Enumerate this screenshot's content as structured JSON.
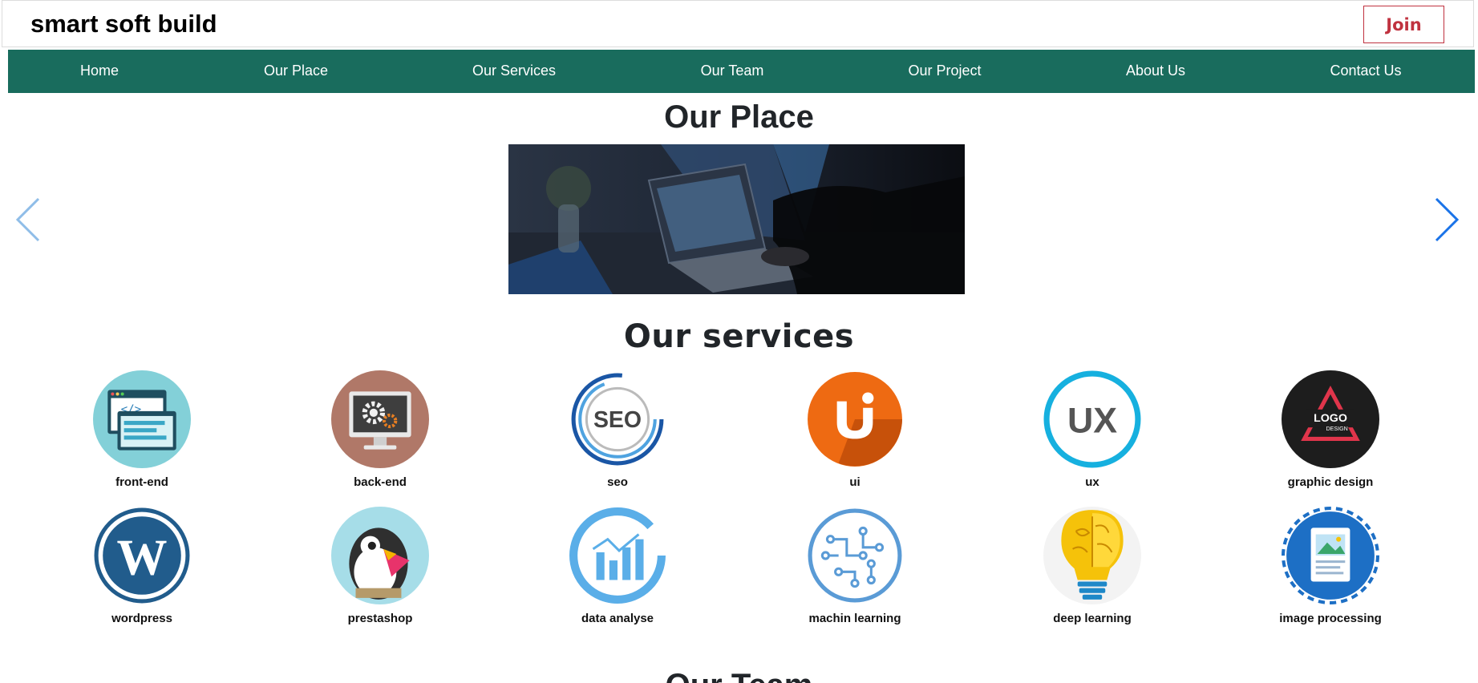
{
  "header": {
    "brand": "smart soft build",
    "join_label": "Join"
  },
  "nav": {
    "items": [
      "Home",
      "Our Place",
      "Our Services",
      "Our Team",
      "Our Project",
      "About Us",
      "Contact Us"
    ]
  },
  "place": {
    "title": "Our Place"
  },
  "services": {
    "title": "Our services",
    "items": [
      {
        "label": "front-end",
        "icon": "code-window-icon"
      },
      {
        "label": "back-end",
        "icon": "monitor-gears-icon"
      },
      {
        "label": "seo",
        "icon": "seo-icon"
      },
      {
        "label": "ui",
        "icon": "ui-icon"
      },
      {
        "label": "ux",
        "icon": "ux-icon"
      },
      {
        "label": "graphic design",
        "icon": "logo-design-icon"
      },
      {
        "label": "wordpress",
        "icon": "wordpress-icon"
      },
      {
        "label": "prestashop",
        "icon": "prestashop-icon"
      },
      {
        "label": "data analyse",
        "icon": "data-chart-icon"
      },
      {
        "label": "machin learning",
        "icon": "circuit-icon"
      },
      {
        "label": "deep learning",
        "icon": "brain-bulb-icon"
      },
      {
        "label": "image processing",
        "icon": "image-document-icon"
      }
    ]
  },
  "team": {
    "title": "Our Team"
  },
  "colors": {
    "nav_bg": "#196c5d",
    "join_accent": "#c0323f",
    "arrow_blue": "#1a73e8"
  }
}
